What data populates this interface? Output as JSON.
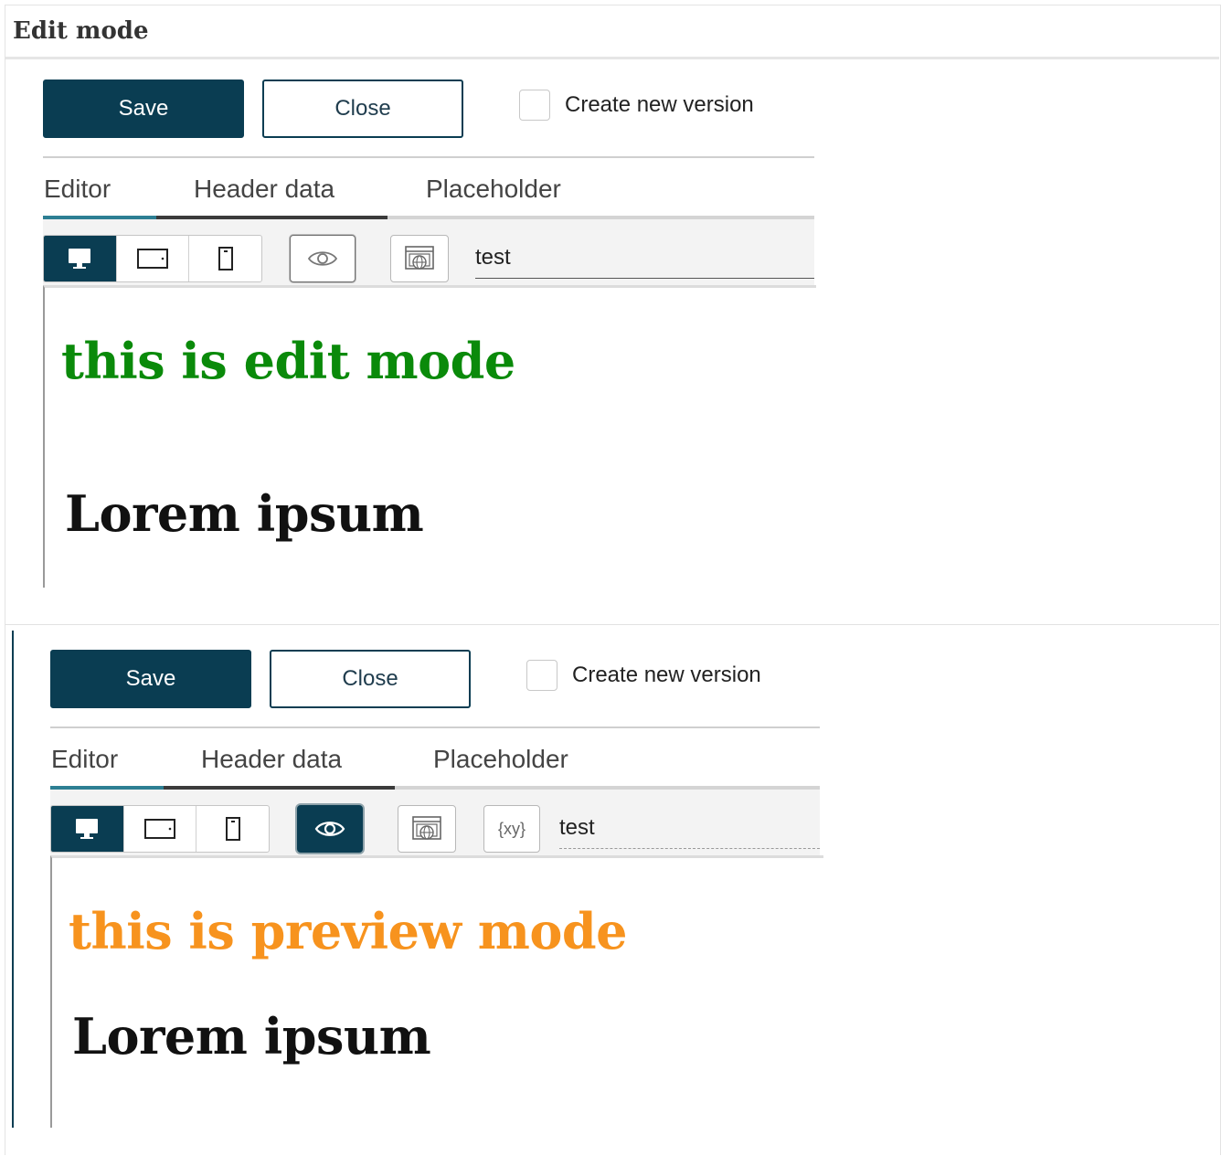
{
  "section_title": "Edit mode",
  "panels": [
    {
      "save_label": "Save",
      "close_label": "Close",
      "checkbox_label": "Create new version",
      "tabs": [
        "Editor",
        "Header data",
        "Placeholder"
      ],
      "field_value": "test",
      "heading": "this is edit mode",
      "heading_color": "#0a8a0a",
      "body_text": "Lorem ipsum",
      "preview_active": false
    },
    {
      "save_label": "Save",
      "close_label": "Close",
      "checkbox_label": "Create new version",
      "tabs": [
        "Editor",
        "Header data",
        "Placeholder"
      ],
      "variable_button_label": "{xy}",
      "field_value": "test",
      "heading": "this is preview mode",
      "heading_color": "#f7931e",
      "body_text": "Lorem ipsum",
      "preview_active": true
    }
  ],
  "colors": {
    "primary": "#0a3d52",
    "tab_active": "#2d7f93"
  },
  "icons": [
    "desktop-icon",
    "tablet-icon",
    "mobile-icon",
    "eye-icon",
    "web-preview-icon",
    "variable-icon"
  ]
}
